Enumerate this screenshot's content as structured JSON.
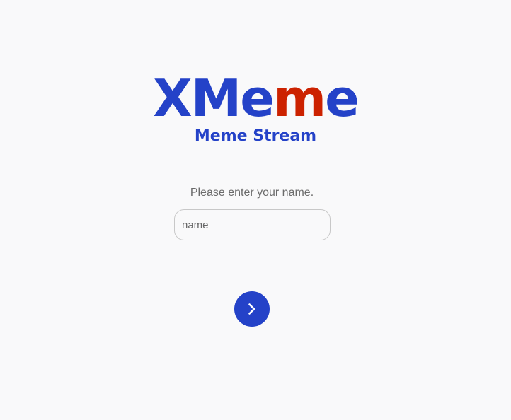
{
  "logo": {
    "part1": "XMe",
    "part2": "m",
    "part3": "e",
    "color_primary": "#2442c8",
    "color_accent": "#cc2200"
  },
  "subtitle": "Meme Stream",
  "form": {
    "prompt": "Please enter your name.",
    "name_placeholder": "name",
    "name_value": "",
    "submit_icon": "chevron-right-icon"
  }
}
